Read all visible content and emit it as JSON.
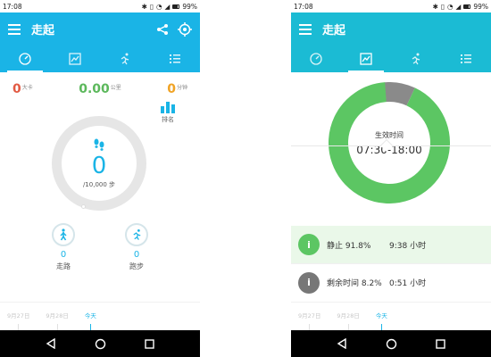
{
  "left": {
    "status": {
      "time": "17:08",
      "battery": "99%"
    },
    "appbar": {
      "title": "走起"
    },
    "stats": {
      "calories": {
        "value": "0",
        "unit": "大卡"
      },
      "distance": {
        "value": "0.00",
        "unit": "公里"
      },
      "minutes": {
        "value": "0",
        "unit": "分钟"
      }
    },
    "steps": {
      "value": "0",
      "goal": "/10,000 步"
    },
    "rank_label": "排名",
    "walk": {
      "value": "0",
      "label": "走路"
    },
    "run": {
      "value": "0",
      "label": "跑步"
    },
    "dates": [
      "9月27日",
      "9月28日",
      "今天"
    ]
  },
  "right": {
    "status": {
      "time": "17:08",
      "battery": "99%"
    },
    "appbar": {
      "title": "走起"
    },
    "donut": {
      "label": "生效时间",
      "range": "07:30-18:00",
      "segments": [
        {
          "name": "静止",
          "percent": 91.8,
          "color": "#5cc663"
        },
        {
          "name": "剩余时间",
          "percent": 8.2,
          "color": "#8a8a8a"
        }
      ]
    },
    "cards": {
      "still": {
        "icon": "i",
        "label": "静止 91.8%",
        "value": "9:38 小时"
      },
      "rest": {
        "icon": "i",
        "label": "剩余时间 8.2%",
        "value": "0:51 小时"
      }
    },
    "dates": [
      "9月27日",
      "9月28日",
      "今天"
    ]
  },
  "colors": {
    "accent_left": "#1ab4e6",
    "accent_right": "#1bbbd4",
    "green": "#5cc663",
    "gray": "#8a8a8a"
  }
}
